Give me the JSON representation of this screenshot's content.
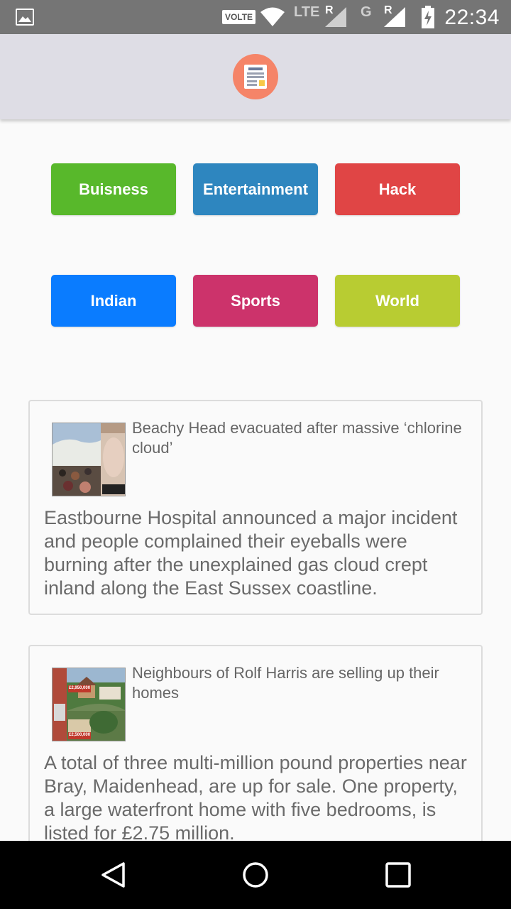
{
  "status_bar": {
    "volte": "VOLTE",
    "lte": "LTE",
    "roaming": "R",
    "network_g": "G",
    "roaming2": "R",
    "time": "22:34",
    "icons": [
      "gallery-icon",
      "wifi-icon",
      "signal-icon",
      "battery-charging-icon"
    ]
  },
  "app_bar": {
    "logo_icon": "newspaper-icon",
    "logo_color": "#f58468"
  },
  "categories": [
    {
      "label": "Buisness",
      "color": "#58b82b"
    },
    {
      "label": "Entertainment",
      "color": "#2e86bf"
    },
    {
      "label": "Hack",
      "color": "#e04545"
    },
    {
      "label": "Indian",
      "color": "#0a7cff"
    },
    {
      "label": "Sports",
      "color": "#cc336b"
    },
    {
      "label": "World",
      "color": "#b8cc32"
    }
  ],
  "news": [
    {
      "title": "Beachy Head evacuated after massive ‘chlorine cloud’",
      "description": "Eastbourne Hospital announced a major incident and people complained their eyeballs were burning after the unexplained gas cloud crept inland along the East Sussex coastline."
    },
    {
      "title": "Neighbours of Rolf Harris are selling up their homes",
      "description": "A total of three multi-million pound properties near Bray, Maidenhead, are up for sale. One property, a large waterfront home with five bedrooms, is listed for £2.75 million.",
      "thumb_labels": [
        "£2,950,000",
        "£2,500,000"
      ]
    }
  ],
  "nav_bar": {
    "icons": [
      "back-icon",
      "home-icon",
      "recents-icon"
    ]
  }
}
